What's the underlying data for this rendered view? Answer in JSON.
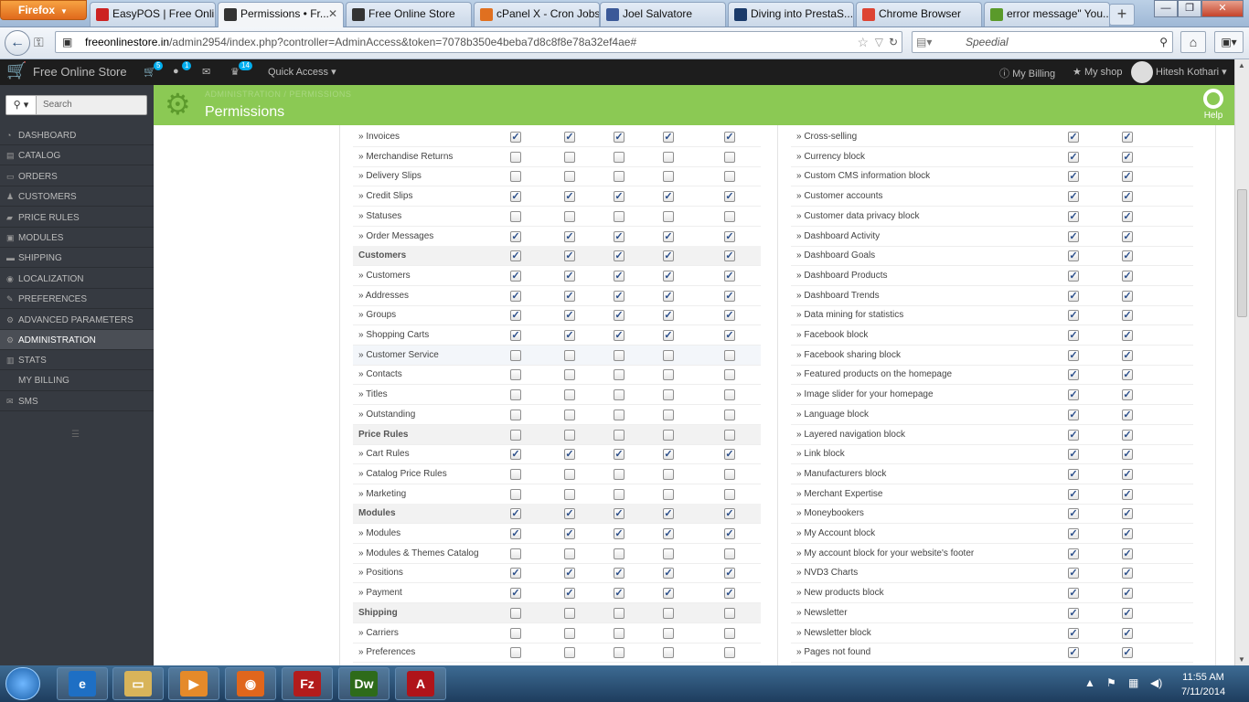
{
  "browser": {
    "menu_label": "Firefox",
    "tabs": [
      {
        "title": "EasyPOS | Free Onli...",
        "icon": "easypos-icon",
        "color": "#cc2222"
      },
      {
        "title": "Permissions • Fr...",
        "icon": "prestashop-icon",
        "color": "#333333"
      },
      {
        "title": "Free Online Store",
        "icon": "prestashop-icon",
        "color": "#333333"
      },
      {
        "title": "cPanel X - Cron Jobs",
        "icon": "cpanel-icon",
        "color": "#e07020"
      },
      {
        "title": "Joel Salvatore",
        "icon": "facebook-icon",
        "color": "#3b5998"
      },
      {
        "title": "Diving into PrestaS...",
        "icon": "prestashop-icon",
        "color": "#1a3a6a"
      },
      {
        "title": "Chrome Browser",
        "icon": "chrome-icon",
        "color": "#dd4433"
      },
      {
        "title": "error message\" You...",
        "icon": "prestashop-forum-icon",
        "color": "#5a9a2a"
      }
    ],
    "url_host": "freeonlinestore.in",
    "url_path": "/admin2954/index.php?controller=AdminAccess&token=7078b350e4beba7d8c8f8e78a32ef4ae#",
    "search_placeholder": "Speedial"
  },
  "admin": {
    "shop_name": "Free Online Store",
    "badges": {
      "orders": "5",
      "customers": "1",
      "messages": "14"
    },
    "quick_access": "Quick Access",
    "my_billing": "My Billing",
    "my_shop": "My shop",
    "user": "Hitesh Kothari",
    "breadcrumb": "ADMINISTRATION  /  PERMISSIONS",
    "page_title": "Permissions",
    "help": "Help",
    "search_label": "Search"
  },
  "sidebar": {
    "items": [
      {
        "label": "DASHBOARD",
        "icon": "dashboard-icon",
        "active": false
      },
      {
        "label": "CATALOG",
        "icon": "catalog-icon",
        "active": false
      },
      {
        "label": "ORDERS",
        "icon": "orders-icon",
        "active": false
      },
      {
        "label": "CUSTOMERS",
        "icon": "customers-icon",
        "active": false
      },
      {
        "label": "PRICE RULES",
        "icon": "price-rules-icon",
        "active": false
      },
      {
        "label": "MODULES",
        "icon": "modules-icon",
        "active": false
      },
      {
        "label": "SHIPPING",
        "icon": "shipping-icon",
        "active": false
      },
      {
        "label": "LOCALIZATION",
        "icon": "localization-icon",
        "active": false
      },
      {
        "label": "PREFERENCES",
        "icon": "preferences-icon",
        "active": false
      },
      {
        "label": "ADVANCED PARAMETERS",
        "icon": "advanced-parameters-icon",
        "active": false
      },
      {
        "label": "ADMINISTRATION",
        "icon": "administration-icon",
        "active": true
      },
      {
        "label": "STATS",
        "icon": "stats-icon",
        "active": false
      },
      {
        "label": "MY BILLING",
        "icon": "",
        "active": false
      },
      {
        "label": "SMS",
        "icon": "sms-icon",
        "active": false
      }
    ]
  },
  "tab_permissions": [
    {
      "label": "» Invoices",
      "type": "item",
      "checks": [
        1,
        1,
        1,
        1,
        1
      ]
    },
    {
      "label": "» Merchandise Returns",
      "type": "item",
      "checks": [
        0,
        0,
        0,
        0,
        0
      ]
    },
    {
      "label": "» Delivery Slips",
      "type": "item",
      "checks": [
        0,
        0,
        0,
        0,
        0
      ]
    },
    {
      "label": "» Credit Slips",
      "type": "item",
      "checks": [
        1,
        1,
        1,
        1,
        1
      ]
    },
    {
      "label": "» Statuses",
      "type": "item",
      "checks": [
        0,
        0,
        0,
        0,
        0
      ]
    },
    {
      "label": "» Order Messages",
      "type": "item",
      "checks": [
        1,
        1,
        1,
        1,
        1
      ]
    },
    {
      "label": "Customers",
      "type": "category",
      "checks": [
        1,
        1,
        1,
        1,
        1
      ]
    },
    {
      "label": "» Customers",
      "type": "item",
      "checks": [
        1,
        1,
        1,
        1,
        1
      ]
    },
    {
      "label": "» Addresses",
      "type": "item",
      "checks": [
        1,
        1,
        1,
        1,
        1
      ]
    },
    {
      "label": "» Groups",
      "type": "item",
      "checks": [
        1,
        1,
        1,
        1,
        1
      ]
    },
    {
      "label": "» Shopping Carts",
      "type": "item",
      "checks": [
        1,
        1,
        1,
        1,
        1
      ]
    },
    {
      "label": "» Customer Service",
      "type": "item",
      "checks": [
        0,
        0,
        0,
        0,
        0
      ],
      "highlight": true
    },
    {
      "label": "» Contacts",
      "type": "item",
      "checks": [
        0,
        0,
        0,
        0,
        0
      ]
    },
    {
      "label": "» Titles",
      "type": "item",
      "checks": [
        0,
        0,
        0,
        0,
        0
      ]
    },
    {
      "label": "» Outstanding",
      "type": "item",
      "checks": [
        0,
        0,
        0,
        0,
        0
      ]
    },
    {
      "label": "Price Rules",
      "type": "category",
      "checks": [
        0,
        0,
        0,
        0,
        0
      ]
    },
    {
      "label": "» Cart Rules",
      "type": "item",
      "checks": [
        1,
        1,
        1,
        1,
        1
      ]
    },
    {
      "label": "» Catalog Price Rules",
      "type": "item",
      "checks": [
        0,
        0,
        0,
        0,
        0
      ]
    },
    {
      "label": "» Marketing",
      "type": "item",
      "checks": [
        0,
        0,
        0,
        0,
        0
      ]
    },
    {
      "label": "Modules",
      "type": "category",
      "checks": [
        1,
        1,
        1,
        1,
        1
      ]
    },
    {
      "label": "» Modules",
      "type": "item",
      "checks": [
        1,
        1,
        1,
        1,
        1
      ]
    },
    {
      "label": "» Modules & Themes Catalog",
      "type": "item",
      "checks": [
        0,
        0,
        0,
        0,
        0
      ]
    },
    {
      "label": "» Positions",
      "type": "item",
      "checks": [
        1,
        1,
        1,
        1,
        1
      ]
    },
    {
      "label": "» Payment",
      "type": "item",
      "checks": [
        1,
        1,
        1,
        1,
        1
      ]
    },
    {
      "label": "Shipping",
      "type": "category",
      "checks": [
        0,
        0,
        0,
        0,
        0
      ]
    },
    {
      "label": "» Carriers",
      "type": "item",
      "checks": [
        0,
        0,
        0,
        0,
        0
      ]
    },
    {
      "label": "» Preferences",
      "type": "item",
      "checks": [
        0,
        0,
        0,
        0,
        0
      ]
    }
  ],
  "module_permissions": [
    {
      "label": "» Cross-selling",
      "checks": [
        1,
        1
      ]
    },
    {
      "label": "» Currency block",
      "checks": [
        1,
        1
      ]
    },
    {
      "label": "» Custom CMS information block",
      "checks": [
        1,
        1
      ]
    },
    {
      "label": "» Customer accounts",
      "checks": [
        1,
        1
      ]
    },
    {
      "label": "» Customer data privacy block",
      "checks": [
        1,
        1
      ]
    },
    {
      "label": "» Dashboard Activity",
      "checks": [
        1,
        1
      ]
    },
    {
      "label": "» Dashboard Goals",
      "checks": [
        1,
        1
      ]
    },
    {
      "label": "» Dashboard Products",
      "checks": [
        1,
        1
      ]
    },
    {
      "label": "» Dashboard Trends",
      "checks": [
        1,
        1
      ]
    },
    {
      "label": "» Data mining for statistics",
      "checks": [
        1,
        1
      ]
    },
    {
      "label": "» Facebook block",
      "checks": [
        1,
        1
      ]
    },
    {
      "label": "» Facebook sharing block",
      "checks": [
        1,
        1
      ]
    },
    {
      "label": "» Featured products on the homepage",
      "checks": [
        1,
        1
      ]
    },
    {
      "label": "» Image slider for your homepage",
      "checks": [
        1,
        1
      ]
    },
    {
      "label": "» Language block",
      "checks": [
        1,
        1
      ]
    },
    {
      "label": "» Layered navigation block",
      "checks": [
        1,
        1
      ]
    },
    {
      "label": "» Link block",
      "checks": [
        1,
        1
      ]
    },
    {
      "label": "» Manufacturers block",
      "checks": [
        1,
        1
      ]
    },
    {
      "label": "» Merchant Expertise",
      "checks": [
        1,
        1
      ]
    },
    {
      "label": "» Moneybookers",
      "checks": [
        1,
        1
      ]
    },
    {
      "label": "» My Account block",
      "checks": [
        1,
        1
      ]
    },
    {
      "label": "» My account block for your website's footer",
      "checks": [
        1,
        1
      ]
    },
    {
      "label": "» NVD3 Charts",
      "checks": [
        1,
        1
      ]
    },
    {
      "label": "» New products block",
      "checks": [
        1,
        1
      ]
    },
    {
      "label": "» Newsletter",
      "checks": [
        1,
        1
      ]
    },
    {
      "label": "» Newsletter block",
      "checks": [
        1,
        1
      ]
    },
    {
      "label": "» Pages not found",
      "checks": [
        1,
        1
      ]
    }
  ],
  "taskbar": {
    "apps": [
      "internet-explorer-icon",
      "windows-explorer-icon",
      "media-player-icon",
      "firefox-icon",
      "filezilla-icon",
      "dreamweaver-icon",
      "acrobat-icon"
    ],
    "time": "11:55 AM",
    "date": "7/11/2014"
  }
}
